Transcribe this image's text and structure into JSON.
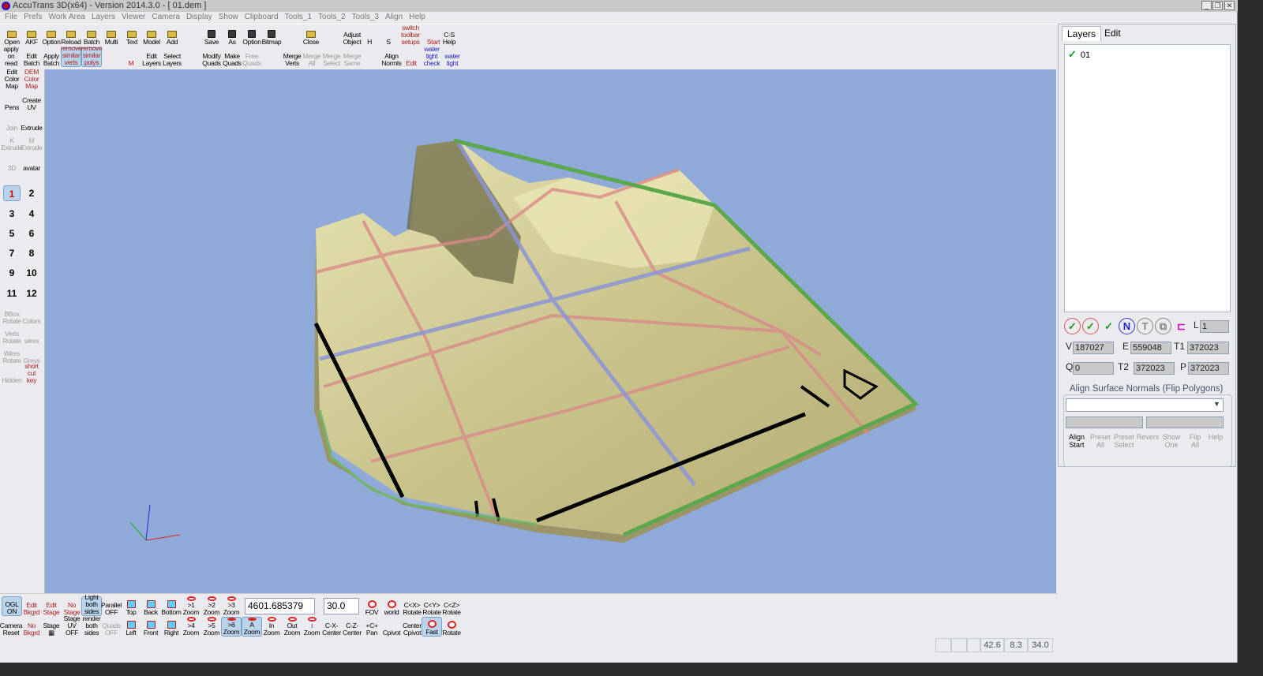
{
  "window": {
    "title": "AccuTrans 3D(x64) - Version 2014.3.0 - [ 01.dem ]",
    "controls": [
      "_",
      "❐",
      "✕"
    ]
  },
  "menu": [
    "File",
    "Prefs",
    "Work Area",
    "Layers",
    "Viewer",
    "Camera",
    "Display",
    "Show",
    "Clipboard",
    "Tools_1",
    "Tools_2",
    "Tools_3",
    "Align",
    "Help"
  ],
  "top_toolbar": {
    "row1": [
      {
        "label": "Open",
        "icon": "folder"
      },
      {
        "label": "AKF",
        "icon": "folder"
      },
      {
        "label": "Option",
        "icon": "folder"
      },
      {
        "label": "Reload",
        "icon": "folder"
      },
      {
        "label": "Batch",
        "icon": "folder"
      },
      {
        "label": "Multi",
        "icon": "folder"
      },
      {
        "label": "Text",
        "icon": "folder"
      },
      {
        "label": "Model",
        "icon": "folder"
      },
      {
        "label": "Add",
        "icon": "folder"
      },
      {
        "label": "Save",
        "icon": "disk"
      },
      {
        "label": "As",
        "icon": "disk"
      },
      {
        "label": "Option",
        "icon": "disk"
      },
      {
        "label": "Bitmap",
        "icon": "disk"
      },
      {
        "label": "Close",
        "icon": "folder"
      },
      {
        "label": "Adjust\nObject",
        "icon": "none"
      },
      {
        "label": "H",
        "icon": "none"
      },
      {
        "label": "S",
        "icon": "none"
      },
      {
        "label": "switch\ntoolbar\nsetups",
        "icon": "none",
        "style": "red"
      },
      {
        "label": "Start",
        "icon": "none",
        "style": "red"
      },
      {
        "label": "C-S\nHelp",
        "icon": "none"
      }
    ],
    "row2": [
      {
        "label": "apply\non\nread",
        "icon": "none"
      },
      {
        "label": "Edit\nBatch",
        "icon": "none"
      },
      {
        "label": "Apply\nBatch",
        "icon": "none"
      },
      {
        "label": "remove\nsimilar\nverts",
        "icon": "none",
        "style": "hl red"
      },
      {
        "label": "remove\nsimilar\npolys",
        "icon": "none",
        "style": "hl red"
      },
      {
        "label": "M",
        "icon": "none",
        "style": "red"
      },
      {
        "label": "Edit\nLayers",
        "icon": "none"
      },
      {
        "label": "Select\nLayers",
        "icon": "none"
      },
      {
        "label": "Modify\nQuads",
        "icon": "none"
      },
      {
        "label": "Make\nQuads",
        "icon": "none"
      },
      {
        "label": "Free\nQuads",
        "icon": "none",
        "style": "grey"
      },
      {
        "label": "Merge\nVerts",
        "icon": "none"
      },
      {
        "label": "Merge\nAll",
        "icon": "none",
        "style": "grey"
      },
      {
        "label": "Merge\nSelect",
        "icon": "none",
        "style": "grey"
      },
      {
        "label": "Merge\nSame",
        "icon": "none",
        "style": "grey"
      },
      {
        "label": "Align\nNormls",
        "icon": "none"
      },
      {
        "label": "Edit",
        "icon": "none",
        "style": "red"
      },
      {
        "label": "water\ntight\ncheck",
        "icon": "none",
        "style": "blue"
      },
      {
        "label": "water\ntight",
        "icon": "none",
        "style": "blue"
      }
    ]
  },
  "left_panel": {
    "tools": [
      {
        "label": "Edit\nColor\nMap"
      },
      {
        "label": "DEM\nColor\nMap",
        "style": "red"
      },
      {
        "label": "Pens"
      },
      {
        "label": "Create\nUV"
      },
      {
        "label": "Join",
        "style": "grey"
      },
      {
        "label": "Extrude"
      },
      {
        "label": "K\nExtrude",
        "style": "grey"
      },
      {
        "label": "M\nExtrude",
        "style": "grey"
      },
      {
        "label": "3D",
        "style": "grey"
      },
      {
        "label": "avatar"
      }
    ],
    "numbers": [
      "1",
      "2",
      "3",
      "4",
      "5",
      "6",
      "7",
      "8",
      "9",
      "10",
      "11",
      "12"
    ],
    "selected_number": "1",
    "tools2": [
      {
        "label": "BBox\nRotate",
        "style": "grey"
      },
      {
        "label": "Colors",
        "style": "grey"
      },
      {
        "label": "Verts\nRotate",
        "style": "grey"
      },
      {
        "label": "wires",
        "style": "grey"
      },
      {
        "label": "Wires\nRotate",
        "style": "grey"
      },
      {
        "label": "Greys",
        "style": "grey"
      },
      {
        "label": "Hidden",
        "style": "grey"
      },
      {
        "label": "short\ncut\nkey",
        "style": "red"
      }
    ]
  },
  "right_panel": {
    "tabs": [
      "Layers",
      "Edit"
    ],
    "active_tab": "Layers",
    "layers": [
      {
        "name": "01",
        "visible": true
      }
    ],
    "icons": [
      "check-all",
      "uncheck-all",
      "swap-check",
      "N",
      "T",
      "copy",
      "tree"
    ],
    "icon_labels": [
      "✓",
      "✓",
      "✓",
      "N",
      "T",
      "⧉",
      "⊏"
    ],
    "L_label": "L",
    "L_value": "1",
    "stats": {
      "V_label": "V",
      "V": "187027",
      "E_label": "E",
      "E": "559048",
      "T1_label": "T1",
      "T1": "372023",
      "Q_label": "Q",
      "Q": "0",
      "T2_label": "T2",
      "T2": "372023",
      "P_label": "P",
      "P": "372023"
    },
    "align_group": {
      "title": "Align Surface Normals (Flip Polygons)",
      "select_value": "",
      "buttons": [
        "Align\nStart",
        "Preset\nAll",
        "Preset\nSelect",
        "Revers",
        "Show\nOne",
        "Flip\nAll",
        "Help"
      ]
    }
  },
  "bottom_toolbar": {
    "row1": [
      {
        "label": "OGL\nON",
        "style": "hl"
      },
      {
        "label": "Edit\nBkgrd",
        "style": "red"
      },
      {
        "label": "Edit\nStage",
        "style": "red"
      },
      {
        "label": "No\nStage",
        "style": "red"
      },
      {
        "label": "Light\nboth\nsides",
        "style": "hl"
      },
      {
        "label": "Parallel\nOFF"
      },
      {
        "label": "Top",
        "icon": "cube"
      },
      {
        "label": "Back",
        "icon": "cube"
      },
      {
        "label": "Bottom",
        "icon": "cube"
      },
      {
        "label": ">1\nZoom",
        "icon": "c"
      },
      {
        "label": ">2\nZoom",
        "icon": "c"
      },
      {
        "label": ">3\nZoom",
        "icon": "c"
      },
      {
        "label": "FOV",
        "icon": "c"
      },
      {
        "label": "world",
        "icon": "c"
      },
      {
        "label": "C<X>\nRotate"
      },
      {
        "label": "C<Y>\nRotate"
      },
      {
        "label": "C<Z>\nRotate"
      }
    ],
    "distance_value": "4601.685379",
    "fov_value": "30.0",
    "row2": [
      {
        "label": "Camera\nReset"
      },
      {
        "label": "No\nBkgrd",
        "style": "red"
      },
      {
        "label": "Stage\n▦"
      },
      {
        "label": "Stage\nUV\nOFF"
      },
      {
        "label": "render\nboth\nsides"
      },
      {
        "label": "Quads\nOFF",
        "style": "grey"
      },
      {
        "label": "Left",
        "icon": "cube"
      },
      {
        "label": "Front",
        "icon": "cube"
      },
      {
        "label": "Right",
        "icon": "cube"
      },
      {
        "label": ">4\nZoom",
        "icon": "c"
      },
      {
        "label": ">5\nZoom",
        "icon": "c"
      },
      {
        "label": ">6\nZoom",
        "icon": "c",
        "style": "hl"
      },
      {
        "label": "A\nZoom",
        "icon": "c",
        "style": "hl"
      },
      {
        "label": "In\nZoom",
        "icon": "c"
      },
      {
        "label": "Out\nZoom",
        "icon": "c"
      },
      {
        "label": "↕\nZoom",
        "icon": "c"
      },
      {
        "label": "C-X-\nCenter"
      },
      {
        "label": "C-Z-\nCenter"
      },
      {
        "label": "+C+\nPan"
      },
      {
        "label": "Cpivot"
      },
      {
        "label": "Center\nCpivot"
      },
      {
        "label": "Fast",
        "icon": "c",
        "style": "hl"
      },
      {
        "label": "Rotate",
        "icon": "c"
      }
    ]
  },
  "status_bar": {
    "values": [
      "",
      "",
      "",
      "42.6",
      "8.3",
      "34.0"
    ]
  },
  "colors": {
    "viewport_bg": "#8faad8",
    "terrain": "#cfc994",
    "grid_red": "#d98a8a",
    "grid_blue": "#8c95d4",
    "edge_green": "#5aa84a"
  }
}
